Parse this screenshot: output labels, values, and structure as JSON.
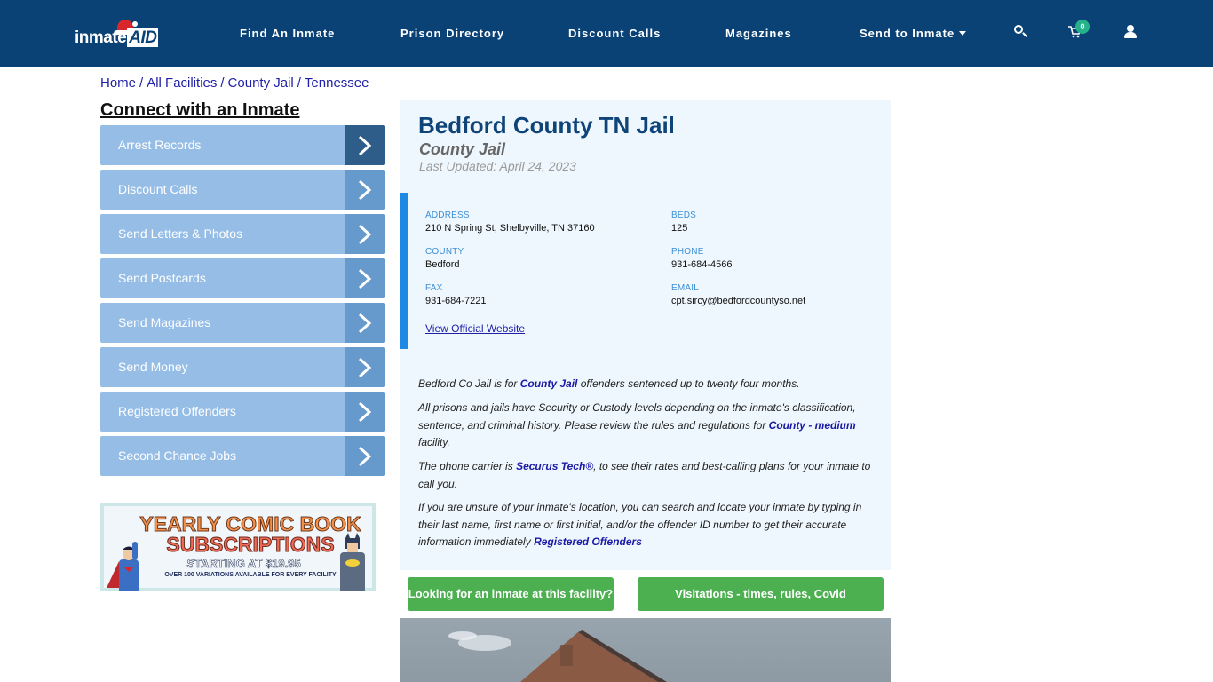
{
  "header": {
    "logo_text": "inmate",
    "logo_accent": "AID",
    "nav": [
      {
        "label": "Find An Inmate"
      },
      {
        "label": "Prison Directory"
      },
      {
        "label": "Discount Calls"
      },
      {
        "label": "Magazines"
      },
      {
        "label": "Send to Inmate",
        "has_dropdown": true
      }
    ],
    "icons": [
      "search-icon",
      "cart-icon",
      "user-icon"
    ],
    "cart_count": "0",
    "colors": {
      "background": "#0b4276",
      "badge": "#24b28a"
    }
  },
  "breadcrumb": [
    {
      "label": "Home"
    },
    {
      "label": "All Facilities"
    },
    {
      "label": "County Jail"
    },
    {
      "label": "Tennessee"
    }
  ],
  "breadcrumb_separator": "/",
  "sidebar": {
    "title": "Connect with an Inmate",
    "items": [
      {
        "label": "Arrest Records",
        "active": true
      },
      {
        "label": "Discount Calls"
      },
      {
        "label": "Send Letters & Photos"
      },
      {
        "label": "Send Postcards"
      },
      {
        "label": "Send Magazines"
      },
      {
        "label": "Send Money"
      },
      {
        "label": "Registered Offenders"
      },
      {
        "label": "Second Chance Jobs"
      }
    ],
    "promo": {
      "line1": "YEARLY COMIC BOOK",
      "line2": "SUBSCRIPTIONS",
      "line3": "STARTING AT $19.95",
      "line4": "OVER 100 VARIATIONS AVAILABLE FOR EVERY FACILITY"
    }
  },
  "facility": {
    "name": "Bedford County TN Jail",
    "type": "County Jail",
    "last_updated": "Last Updated: April 24, 2023",
    "fields": {
      "address": {
        "label": "ADDRESS",
        "value": "210 N Spring St, Shelbyville, TN 37160"
      },
      "beds": {
        "label": "BEDS",
        "value": "125"
      },
      "county": {
        "label": "COUNTY",
        "value": "Bedford"
      },
      "phone": {
        "label": "PHONE",
        "value": "931-684-4566"
      },
      "fax": {
        "label": "FAX",
        "value": "931-684-7221"
      },
      "email": {
        "label": "EMAIL",
        "value": "cpt.sircy@bedfordcountyso.net"
      }
    },
    "website_link": "View Official Website",
    "description": {
      "p1": {
        "pre": "Bedford Co Jail is for ",
        "link": "County Jail",
        "post": " offenders sentenced up to twenty four months."
      },
      "p2": {
        "pre": "All prisons and jails have Security or Custody levels depending on the inmate's classification, sentence, and criminal history. Please review the rules and regulations for ",
        "link": "County - medium",
        "post": " facility."
      },
      "p3": {
        "pre": "The phone carrier is ",
        "link": "Securus Tech®",
        "post": ", to see their rates and best-calling plans for your inmate to call you."
      },
      "p4": {
        "pre": "If you are unsure of your inmate's location, you can search and locate your inmate by typing in their last name, first name or first initial, and/or the offender ID number to get their accurate information immediately ",
        "link": "Registered Offenders",
        "post": ""
      }
    },
    "buttons": {
      "find_inmate": "Looking for an inmate at this facility?",
      "visitation": "Visitations - times, rules, Covid cancellations"
    },
    "colors": {
      "title": "#0f4478",
      "card_bg": "#eef7fd",
      "accent_bar": "#1e88e5",
      "button": "#4caf50"
    }
  }
}
